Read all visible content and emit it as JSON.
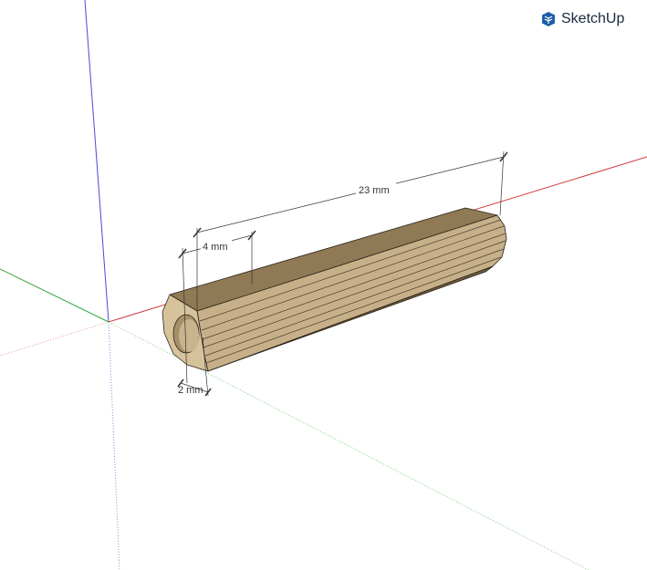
{
  "brand": {
    "name": "SketchUp",
    "icon": "sketchup-logo-icon",
    "color": "#1b5fa8"
  },
  "model": {
    "name": "fluted tube",
    "material_color": "#c9b28a"
  },
  "dimensions": [
    {
      "name": "length",
      "label": "23 mm"
    },
    {
      "name": "outer-diameter",
      "label": "4 mm"
    },
    {
      "name": "hole-diameter",
      "label": "2 mm"
    }
  ],
  "axes": {
    "red": "#d33b3b",
    "green": "#3aa83a",
    "blue": "#3b3bd3"
  }
}
